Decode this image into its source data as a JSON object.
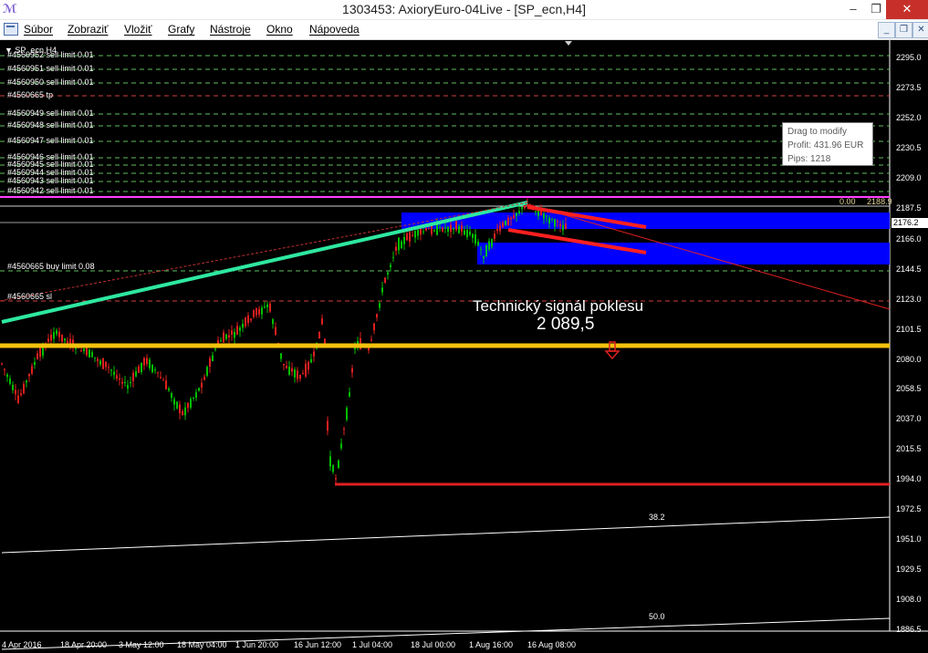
{
  "window": {
    "title": "1303453: AxioryEuro-04Live - [SP_ecn,H4]",
    "app_icon": "metatrader-icon",
    "minimize": "–",
    "restore": "❐",
    "close": "✕"
  },
  "menu": {
    "items": [
      "Súbor",
      "Zobraziť",
      "Vložiť",
      "Grafy",
      "Nástroje",
      "Okno",
      "Nápoveda"
    ],
    "mdi_minimize": "_",
    "mdi_restore": "❐",
    "mdi_close": "✕"
  },
  "chart": {
    "symbol": "SP_ecn,H4",
    "current_price": "2176.2",
    "price_axis": [
      "2295.0",
      "2273.5",
      "2252.0",
      "2230.5",
      "2209.0",
      "2187.5",
      "2166.0",
      "2144.5",
      "2123.0",
      "2101.5",
      "2080.0",
      "2058.5",
      "2037.0",
      "2015.5",
      "1994.0",
      "1972.5",
      "1951.0",
      "1929.5",
      "1908.0",
      "1886.5"
    ],
    "date_axis": [
      "4 Apr 2016",
      "18 Apr 20:00",
      "3 May 12:00",
      "18 May 04:00",
      "1 Jun 20:00",
      "16 Jun 12:00",
      "1 Jul 04:00",
      "18 Jul 00:00",
      "1 Aug 16:00",
      "16 Aug 08:00"
    ],
    "order_labels": [
      "#4560952 sell limit 0.01",
      "#4560951 sell limit 0.01",
      "#4560950 sell limit 0.01",
      "#4560665 tp",
      "#4560949 sell limit 0.01",
      "#4560948 sell limit 0.01",
      "#4560947 sell limit 0.01",
      "#4560946 sell limit 0.01",
      "#4560945 sell limit 0.01",
      "#4560944 sell limit 0.01",
      "#4560943 sell limit 0.01",
      "#4560942 sell limit 0.01",
      "#4560665 buy limit 0.08",
      "#4560665 sl"
    ],
    "tooltip": {
      "line1": "Drag to modify",
      "line2": "Profit: 431.96 EUR",
      "line3": "Pips: 1218"
    },
    "signal": {
      "title": "Technický signál poklesu",
      "value": "2 089,5"
    },
    "fib": {
      "zero": "0.00",
      "zero_price": "2188.9",
      "level_382": "38.2",
      "level_50": "50.0"
    },
    "colors": {
      "background": "#000000",
      "bull_candle": "#00c000",
      "bear_candle": "#e02020",
      "trendline_up": "#2ee8a0",
      "support_line": "#f4c20d",
      "resistance_red": "#ff2020",
      "zone_blue": "#0000ff",
      "tp_line": "#ff40ff"
    }
  }
}
